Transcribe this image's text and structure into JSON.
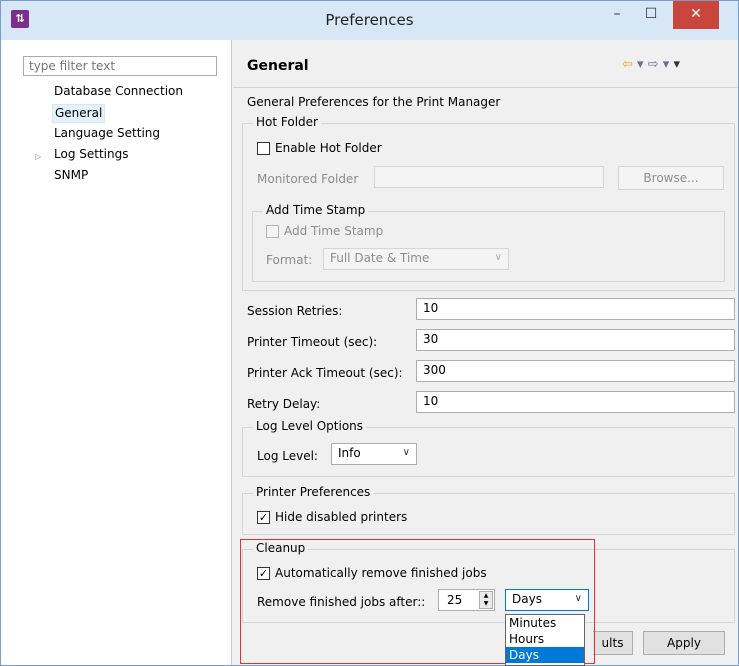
{
  "window": {
    "title": "Preferences",
    "app_icon": "preferences-app-icon",
    "minimize": "–",
    "maximize": "☐",
    "close": "✕"
  },
  "left": {
    "filter_placeholder": "type filter text",
    "items": [
      {
        "label": "Database Connection"
      },
      {
        "label": "General",
        "selected": true
      },
      {
        "label": "Language Setting"
      },
      {
        "label": "Log Settings",
        "expandable": true
      },
      {
        "label": "SNMP"
      }
    ]
  },
  "page": {
    "title": "General",
    "description": "General Preferences for the Print Manager",
    "hot_folder": {
      "title": "Hot Folder",
      "enable_label": "Enable Hot Folder",
      "monitored_label": "Monitored Folder",
      "browse_label": "Browse...",
      "timestamp_group": "Add Time Stamp",
      "timestamp_checkbox": "Add Time Stamp",
      "format_label": "Format:",
      "format_value": "Full Date & Time"
    },
    "fields": [
      {
        "label": "Session Retries:",
        "value": "10"
      },
      {
        "label": "Printer Timeout (sec):",
        "value": "30"
      },
      {
        "label": "Printer Ack Timeout (sec):",
        "value": "300"
      },
      {
        "label": "Retry Delay:",
        "value": "10"
      }
    ],
    "log_level": {
      "title": "Log Level Options",
      "label": "Log Level:",
      "value": "Info"
    },
    "printer_prefs": {
      "title": "Printer Preferences",
      "hide_disabled": "Hide disabled printers",
      "checked": true
    },
    "cleanup": {
      "title": "Cleanup",
      "auto_remove": "Automatically remove finished jobs",
      "checked": true,
      "remove_after_label": "Remove finished jobs after::",
      "remove_after_value": "25",
      "unit_value": "Days",
      "unit_options": [
        "Minutes",
        "Hours",
        "Days"
      ]
    },
    "buttons": {
      "restore_partial": "ults",
      "apply": "Apply"
    }
  },
  "colors": {
    "accent": "#0078d7",
    "highlight_border": "#e8302c",
    "close_button": "#c9463d"
  }
}
